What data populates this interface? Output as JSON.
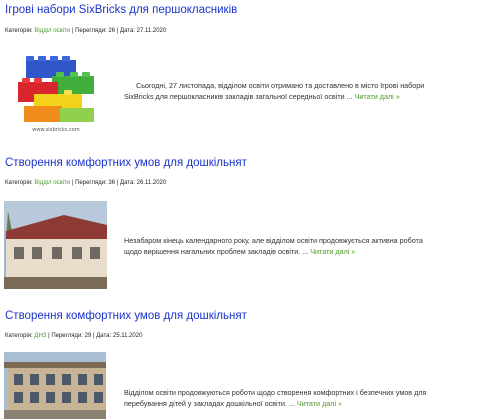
{
  "articles": [
    {
      "title": "Ігрові набори SixBricks для першокласників",
      "meta": {
        "category_label": "Категорія:",
        "category": "Відділ освіти",
        "views_label": "Перегляди:",
        "views": "26",
        "date_label": "Дата:",
        "date": "27.11.2020"
      },
      "thumbnail": {
        "icon": "lego-bricks-image",
        "caption": "www.sixbricks.com"
      },
      "excerpt_lines": [
        "Сьогодні, 27 листопада, відділом освіти отримано та доставлено в місто  Ігрові набори",
        "SixBricks для першокласників закладів загальної середньої освіти ..."
      ],
      "read_more": "Читати далі »"
    },
    {
      "title": "Створення комфортних умов для дошкільнят",
      "meta": {
        "category_label": "Категорія:",
        "category": "Відділ освіти",
        "views_label": "Перегляди:",
        "views": "36",
        "date_label": "Дата:",
        "date": "26.11.2020"
      },
      "thumbnail": {
        "icon": "building-photo"
      },
      "excerpt_lines": [
        "Незабаром кінець календарного року, але відділом освіти продовжується активна робота",
        "щодо вирішення нагальних проблем закладів освіти.  ..."
      ],
      "read_more": "Читати далі »"
    },
    {
      "title": "Створення комфортних умов для дошкільнят",
      "meta": {
        "category_label": "Категорія:",
        "category": "ДНЗ",
        "views_label": "Перегляди:",
        "views": "29",
        "date_label": "Дата:",
        "date": "25.11.2020"
      },
      "thumbnail": {
        "icon": "kindergarten-photo"
      },
      "excerpt_lines": [
        "Відділом освіти продовжуються роботи щодо створення комфортних і безпечних умов для",
        "перебування дітей у закладах дошкільної освіти.  ..."
      ],
      "read_more": "Читати далі »"
    }
  ]
}
